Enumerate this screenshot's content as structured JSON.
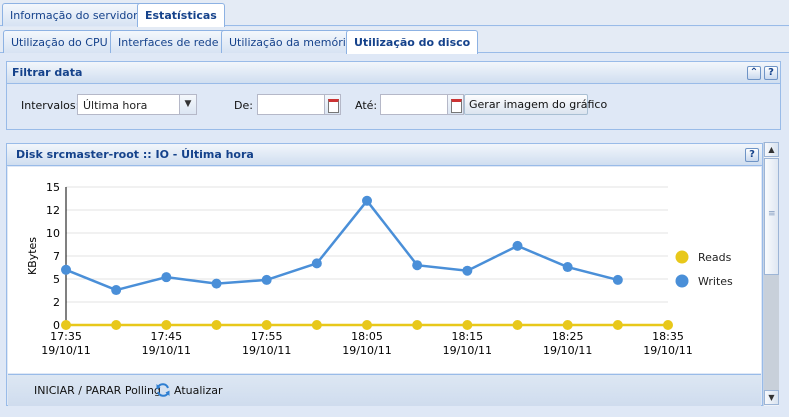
{
  "top_tabs": [
    {
      "label": "Informação do servidor",
      "active": false
    },
    {
      "label": "Estatísticas",
      "active": true
    }
  ],
  "sub_tabs": [
    {
      "label": "Utilização do CPU",
      "active": false
    },
    {
      "label": "Interfaces de rede",
      "active": false
    },
    {
      "label": "Utilização da memória",
      "active": false
    },
    {
      "label": "Utilização do disco",
      "active": true
    }
  ],
  "filter": {
    "title": "Filtrar data",
    "interval_label": "Intervalos:",
    "interval_value": "Última hora",
    "from_label": "De:",
    "from_value": "",
    "to_label": "Até:",
    "to_value": "",
    "graph_button": "Gerar imagem do gráfico",
    "collapse_icon": "double-chevron-up-icon",
    "help_icon": "question-icon"
  },
  "chart_panel": {
    "title": "Disk srcmaster-root :: IO - Última hora",
    "help_icon": "question-icon",
    "polling_label": "INICIAR / PARAR Polling",
    "refresh_label": "Atualizar",
    "refresh_icon": "refresh-icon"
  },
  "chart_data": {
    "type": "line",
    "title": "",
    "xlabel": "",
    "ylabel": "KBytes",
    "ylim": [
      0,
      15
    ],
    "yticks": [
      "0",
      "2",
      "5",
      "7",
      "10",
      "12",
      "15"
    ],
    "ytick_values": [
      0,
      2.5,
      5,
      7.5,
      10,
      12.5,
      15
    ],
    "x_ticks": [
      {
        "time": "17:35",
        "date": "19/10/11"
      },
      {
        "time": "17:45",
        "date": "19/10/11"
      },
      {
        "time": "17:55",
        "date": "19/10/11"
      },
      {
        "time": "18:05",
        "date": "19/10/11"
      },
      {
        "time": "18:15",
        "date": "19/10/11"
      },
      {
        "time": "18:25",
        "date": "19/10/11"
      },
      {
        "time": "18:35",
        "date": "19/10/11"
      }
    ],
    "x": [
      "17:35",
      "17:40",
      "17:45",
      "17:50",
      "17:55",
      "18:00",
      "18:05",
      "18:10",
      "18:15",
      "18:20",
      "18:25",
      "18:30",
      "18:35"
    ],
    "grid": true,
    "legend_position": "right",
    "series": [
      {
        "name": "Reads",
        "color": "#e8c81a",
        "values": [
          0,
          0,
          0,
          0,
          0,
          0,
          0,
          0,
          0,
          0,
          0,
          0,
          0
        ]
      },
      {
        "name": "Writes",
        "color": "#4a8fd8",
        "values": [
          6.0,
          3.8,
          5.2,
          4.5,
          4.9,
          6.7,
          13.5,
          6.5,
          5.9,
          8.6,
          6.3,
          4.9,
          null
        ]
      }
    ]
  }
}
